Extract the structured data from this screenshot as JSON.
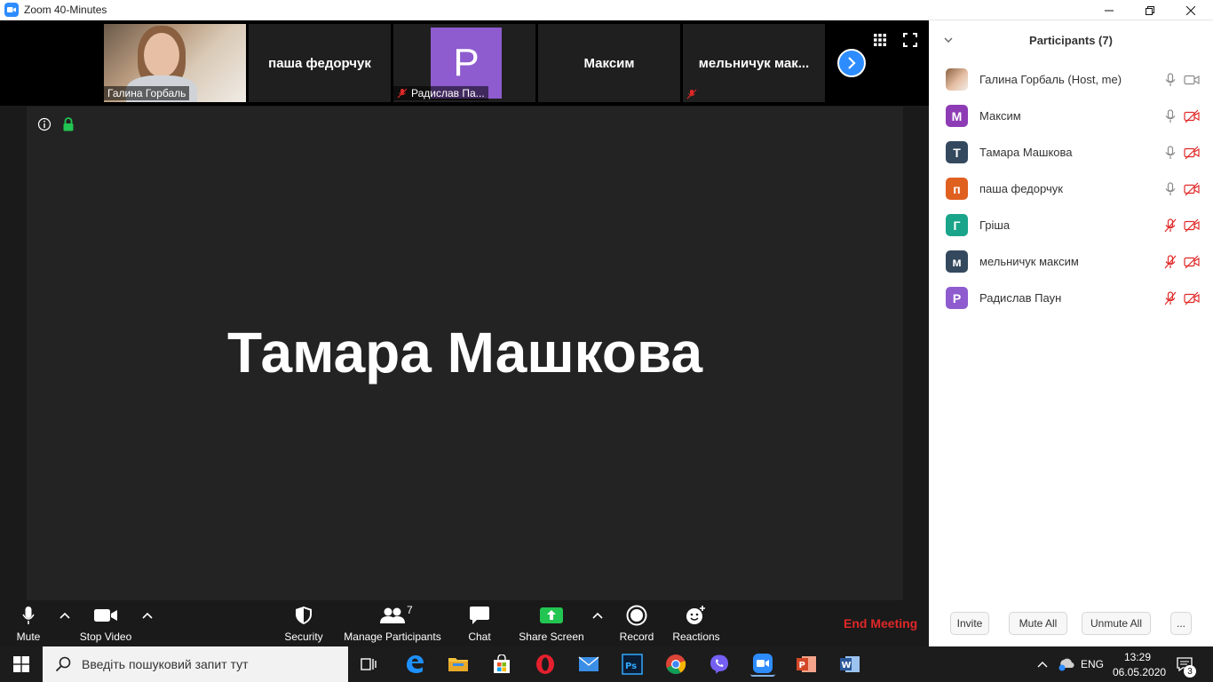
{
  "window": {
    "title": "Zoom 40-Minutes"
  },
  "thumbnails": [
    {
      "name": "Галина Горбаль",
      "type": "video"
    },
    {
      "name": "паша федорчук",
      "type": "name"
    },
    {
      "name": "Радислав Па...",
      "initial": "P",
      "type": "avatar",
      "muted": true
    },
    {
      "name": "Максим",
      "type": "name"
    },
    {
      "name": "мельничук  мак...",
      "type": "name",
      "muted": true
    }
  ],
  "main": {
    "speaker": "Тамара Машкова"
  },
  "toolbar": {
    "mute": "Mute",
    "stop_video": "Stop Video",
    "security": "Security",
    "manage_participants": "Manage Participants",
    "participants_count": "7",
    "chat": "Chat",
    "share_screen": "Share Screen",
    "record": "Record",
    "reactions": "Reactions",
    "end_meeting": "End Meeting"
  },
  "panel": {
    "title": "Participants (7)",
    "participants": [
      {
        "name": "Галина Горбаль (Host, me)",
        "initial": "",
        "color": "#c98a6a",
        "mic_on": true,
        "video_on": true
      },
      {
        "name": "Максим",
        "initial": "М",
        "color": "#8e3cb5",
        "mic_on": true,
        "video_on": false
      },
      {
        "name": "Тамара Машкова",
        "initial": "Т",
        "color": "#34495e",
        "mic_on": true,
        "video_on": false
      },
      {
        "name": "паша федорчук",
        "initial": "п",
        "color": "#e06020",
        "mic_on": true,
        "video_on": false
      },
      {
        "name": "Гріша",
        "initial": "Г",
        "color": "#1aa58a",
        "mic_on": false,
        "video_on": false
      },
      {
        "name": "мельничук максим",
        "initial": "м",
        "color": "#34495e",
        "mic_on": false,
        "video_on": false
      },
      {
        "name": "Радислав Паун",
        "initial": "Р",
        "color": "#8e5ccf",
        "mic_on": false,
        "video_on": false
      }
    ],
    "invite": "Invite",
    "mute_all": "Mute All",
    "unmute_all": "Unmute All",
    "more": "..."
  },
  "taskbar": {
    "search_placeholder": "Введіть пошуковий запит тут",
    "language": "ENG",
    "time": "13:29",
    "date": "06.05.2020",
    "notifications": "3"
  },
  "colors": {
    "accent": "#2d8cff",
    "end": "#e02828",
    "muted": "#e02828",
    "share": "#23c552"
  }
}
